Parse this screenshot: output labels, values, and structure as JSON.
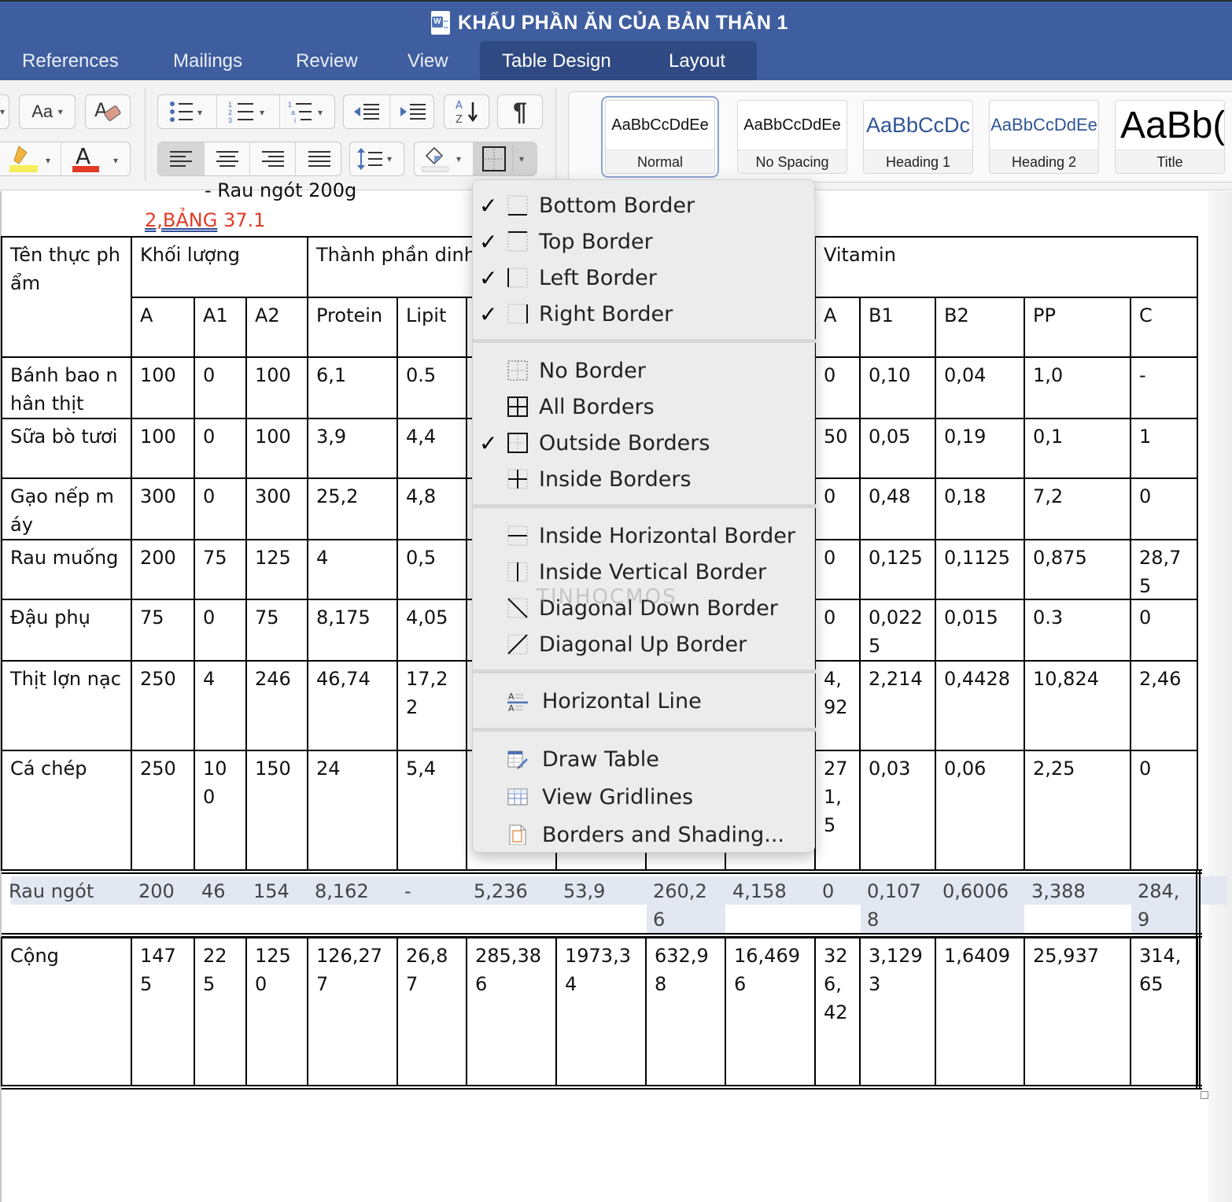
{
  "window": {
    "title": "KHẨU PHẦN ĂN CỦA BẢN THÂN 1"
  },
  "ribbon_tabs": [
    {
      "label": "References",
      "active": false
    },
    {
      "label": "Mailings",
      "active": false
    },
    {
      "label": "Review",
      "active": false
    },
    {
      "label": "View",
      "active": false
    },
    {
      "label": "Table Design",
      "active": true
    },
    {
      "label": "Layout",
      "active": false
    }
  ],
  "toolbar": {
    "change_case_icon": "Aa",
    "paragraph_mark": "¶",
    "font_color_letter": "A",
    "highlight_color": "#f5ee5a",
    "font_color": "#e23b26",
    "sort_icon_top": "A",
    "sort_icon_bottom": "Z"
  },
  "styles_gallery": [
    {
      "sample": "AaBbCcDdEe",
      "label": "Normal",
      "selected": true,
      "color": "#111111"
    },
    {
      "sample": "AaBbCcDdEe",
      "label": "No Spacing",
      "selected": false,
      "color": "#111111"
    },
    {
      "sample": "AaBbCcDc",
      "label": "Heading 1",
      "selected": false,
      "color": "#2f5597"
    },
    {
      "sample": "AaBbCcDdEe",
      "label": "Heading 2",
      "selected": false,
      "color": "#2f5597"
    },
    {
      "sample": "AaBb(",
      "label": "Title",
      "selected": false,
      "color": "#000000"
    }
  ],
  "document": {
    "partial_line": "- Rau ngót 200g",
    "caption_underlined": "2,BẢNG",
    "caption_rest": " 37.1"
  },
  "table": {
    "header": {
      "name": "Tên thực phẩm",
      "mass": "Khối lượng",
      "nutrition": "Thành phần dinh dưỡng",
      "vitamin": "Vitamin"
    },
    "subheaders": [
      "A",
      "A1",
      "A2",
      "Protein",
      "Lipit",
      "",
      "",
      "",
      "",
      "A",
      "B1",
      "B2",
      "PP",
      "C"
    ],
    "rows": [
      {
        "name": "Bánh bao nhân thịt",
        "cells": [
          "100",
          "0",
          "100",
          "6,1",
          "0.5",
          "",
          "",
          "",
          "",
          "0",
          "0,10",
          "0,04",
          "1,0",
          "-"
        ]
      },
      {
        "name": "Sữa bò tươi",
        "cells": [
          "100",
          "0",
          "100",
          "3,9",
          "4,4",
          "",
          "",
          "",
          "",
          "50",
          "0,05",
          "0,19",
          "0,1",
          "1"
        ]
      },
      {
        "name": "Gạo nếp máy",
        "cells": [
          "300",
          "0",
          "300",
          "25,2",
          "4,8",
          "",
          "",
          "",
          "",
          "0",
          "0,48",
          "0,18",
          "7,2",
          "0"
        ]
      },
      {
        "name": "Rau muống",
        "cells": [
          "200",
          "75",
          "125",
          "4",
          "0,5",
          "",
          "",
          "",
          "",
          "0",
          "0,125",
          "0,1125",
          "0,875",
          "28,75"
        ]
      },
      {
        "name": "Đậu phụ",
        "cells": [
          "75",
          "0",
          "75",
          "8,175",
          "4,05",
          "",
          "",
          "",
          "",
          "0",
          "0,0225",
          "0,015",
          "0.3",
          "0"
        ]
      },
      {
        "name": "Thịt lợn nạc",
        "cells": [
          "250",
          "4",
          "246",
          "46,74",
          "17,22",
          "",
          "",
          "",
          "",
          "4,92",
          "2,214",
          "0,4428",
          "10,824",
          "2,46"
        ]
      },
      {
        "name": "Cá chép",
        "cells": [
          "250",
          "100",
          "150",
          "24",
          "5,4",
          "",
          "",
          "",
          "",
          "271,5",
          "0,03",
          "0,06",
          "2,25",
          "0"
        ]
      }
    ],
    "selected_row": {
      "name": "Rau ngót",
      "cells": [
        "200",
        "46",
        "154",
        "8,162",
        "-",
        "5,236",
        "53,9",
        "260,26",
        "4,158",
        "0",
        "0,1078",
        "0,6006",
        "3,388",
        "284,9"
      ]
    },
    "total_row": {
      "name": "Cộng",
      "cells": [
        "1475",
        "225",
        "1250",
        "126,277",
        "26,87",
        "285,386",
        "1973,34",
        "632,98",
        "16,4696",
        "326,42",
        "3,1293",
        "1,6409",
        "25,937",
        "314,65"
      ]
    }
  },
  "borders_menu": {
    "groups": [
      [
        {
          "label": "Bottom Border",
          "checked": true,
          "icon": "bottom-border-icon"
        },
        {
          "label": "Top Border",
          "checked": true,
          "icon": "top-border-icon"
        },
        {
          "label": "Left Border",
          "checked": true,
          "icon": "left-border-icon"
        },
        {
          "label": "Right Border",
          "checked": true,
          "icon": "right-border-icon"
        }
      ],
      [
        {
          "label": "No Border",
          "checked": false,
          "icon": "no-border-icon"
        },
        {
          "label": "All Borders",
          "checked": false,
          "icon": "all-borders-icon"
        },
        {
          "label": "Outside Borders",
          "checked": true,
          "icon": "outside-borders-icon"
        },
        {
          "label": "Inside Borders",
          "checked": false,
          "icon": "inside-borders-icon"
        }
      ],
      [
        {
          "label": "Inside Horizontal Border",
          "checked": false,
          "icon": "inside-horizontal-border-icon"
        },
        {
          "label": "Inside Vertical Border",
          "checked": false,
          "icon": "inside-vertical-border-icon"
        },
        {
          "label": "Diagonal Down Border",
          "checked": false,
          "icon": "diagonal-down-border-icon"
        },
        {
          "label": "Diagonal Up Border",
          "checked": false,
          "icon": "diagonal-up-border-icon"
        }
      ],
      [
        {
          "label": "Horizontal Line",
          "checked": false,
          "icon": "horizontal-line-icon"
        }
      ],
      [
        {
          "label": "Draw Table",
          "checked": false,
          "icon": "draw-table-icon"
        },
        {
          "label": "View Gridlines",
          "checked": false,
          "icon": "view-gridlines-icon"
        },
        {
          "label": "Borders and Shading...",
          "checked": false,
          "icon": "borders-and-shading-icon"
        }
      ]
    ],
    "check_glyph": "✓",
    "watermark": "TINHOCMOS"
  },
  "annotation": {
    "arrow_color": "#e53a25",
    "points_to": "Outside Borders"
  }
}
